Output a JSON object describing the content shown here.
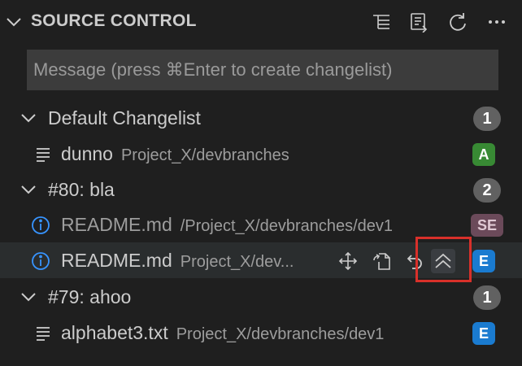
{
  "header": {
    "title": "SOURCE CONTROL",
    "actions": [
      "view-as-tree-icon",
      "commit-icon",
      "refresh-icon",
      "more-actions-icon"
    ]
  },
  "message": {
    "placeholder": "Message (press ⌘Enter to create changelist)",
    "value": ""
  },
  "groups": [
    {
      "label": "Default Changelist",
      "count": "1",
      "files": [
        {
          "name": "dunno",
          "path": "Project_X/devbranches",
          "status": "A",
          "icon": "lines-file-icon"
        }
      ]
    },
    {
      "label": "#80: bla",
      "count": "2",
      "files": [
        {
          "name": "README.md",
          "path": "/Project_X/devbranches/dev1",
          "status": "SE",
          "icon": "info-icon"
        },
        {
          "name": "README.md",
          "path": "Project_X/dev...",
          "status": "E",
          "icon": "info-icon",
          "actions": [
            "move-icon",
            "open-file-icon",
            "discard-icon",
            "shelve-icon"
          ]
        }
      ]
    },
    {
      "label": "#79: ahoo",
      "count": "1",
      "files": [
        {
          "name": "alphabet3.txt",
          "path": "Project_X/devbranches/dev1",
          "status": "E",
          "icon": "lines-file-icon"
        }
      ]
    }
  ],
  "colors": {
    "background": "#1f1f1f",
    "status_added": "#388a34",
    "status_edited": "#1a7bd0",
    "highlight": "#d8302a"
  }
}
